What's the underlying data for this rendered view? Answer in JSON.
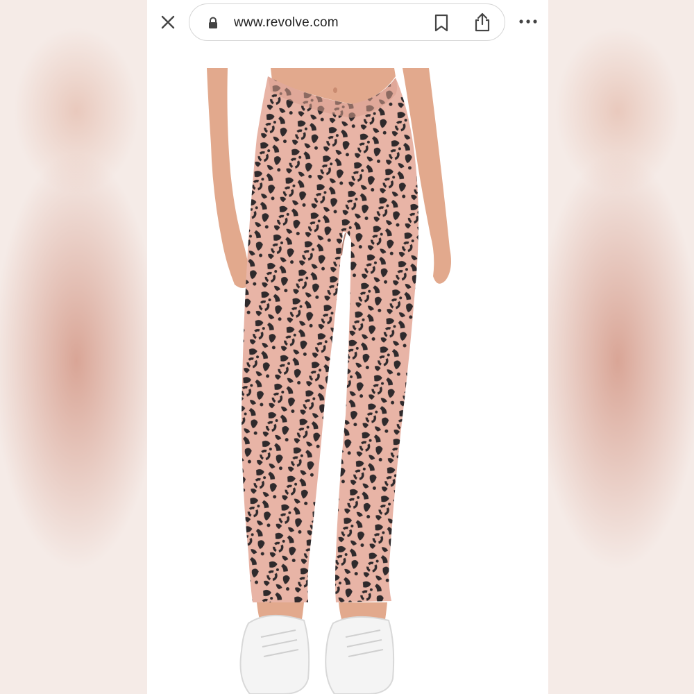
{
  "browser": {
    "url": "www.revolve.com",
    "close_icon": "close-icon",
    "lock_icon": "lock-icon",
    "bookmark_icon": "bookmark-icon",
    "share_icon": "share-icon",
    "more_icon": "more-horizontal-icon"
  },
  "product": {
    "image": "leopard-print-leggings-photo"
  },
  "colors": {
    "legging_base": "#e8b4a6",
    "spot": "#2f2a2c",
    "skin": "#e2a98d",
    "sneaker": "#f4f4f4"
  }
}
